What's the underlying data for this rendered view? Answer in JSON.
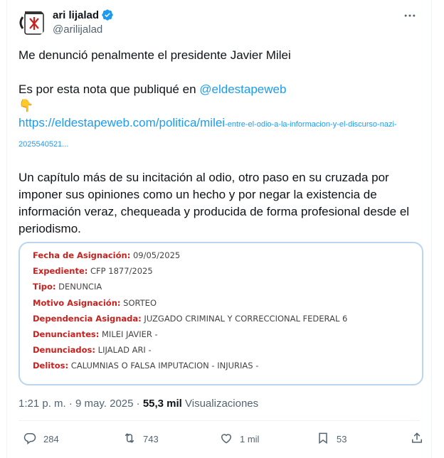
{
  "author": {
    "name": "ari lijalad",
    "handle": "@arilijalad"
  },
  "tweet": {
    "line1": "Me denunció penalmente el presidente Javier Milei",
    "line2_prefix": "Es por esta nota que publiqué en ",
    "mention": "@eldestapeweb",
    "emoji": "👇",
    "url_big": "https://eldestapeweb.com/politica/milei",
    "url_small": "-entre-el-odio-a-la-informacion-y-el-discurso-nazi-",
    "url_tail": "2025540521...",
    "paragraph": "Un capítulo más de su incitación al odio, otro paso en su cruzada por imponer sus opiniones como un hecho y por negar la existencia de información veraz, chequeada y producida de forma profesional desde el periodismo."
  },
  "document": {
    "rows": [
      {
        "key": "Fecha de Asignación:",
        "value": " 09/05/2025"
      },
      {
        "key": "Expediente:",
        "value": " CFP 1877/2025"
      },
      {
        "key": "Tipo:",
        "value": " DENUNCIA"
      },
      {
        "key": "Motivo Asignación:",
        "value": " SORTEO"
      },
      {
        "key": "Dependencia Asignada:",
        "value": " JUZGADO CRIMINAL Y CORRECCIONAL FEDERAL 6"
      },
      {
        "key": "Denunciantes:",
        "value": " MILEI JAVIER -"
      },
      {
        "key": "Denunciados:",
        "value": " LIJALAD ARI -"
      },
      {
        "key": "Delitos:",
        "value": " CALUMNIAS O FALSA IMPUTACION - INJURIAS -"
      }
    ]
  },
  "meta": {
    "timestamp": "1:21 p. m. · 9 may. 2025 · ",
    "views_count": "55,3 mil",
    "views_label": " Visualizaciones"
  },
  "actions": {
    "replies": "284",
    "reposts": "743",
    "likes": "1 mil",
    "bookmarks": "53"
  },
  "colors": {
    "link": "#1d9bf0",
    "doc_key": "#c9211e",
    "doc_border": "#b9d6ee",
    "secondary": "#536471"
  }
}
